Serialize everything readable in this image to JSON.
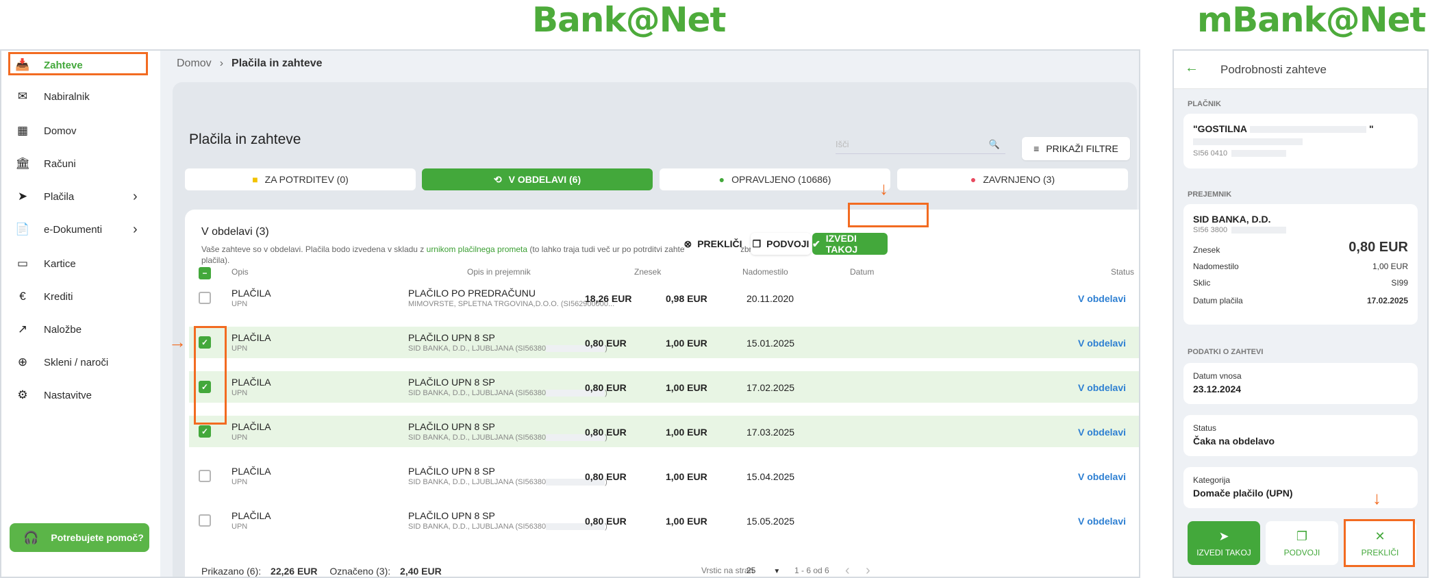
{
  "headers": {
    "desktop": "Bank@Net",
    "mobile": "mBank@Net"
  },
  "sidebar": {
    "items": [
      {
        "label": "Zahteve",
        "icon": "inbox-icon",
        "glyph": "📥",
        "chev": ""
      },
      {
        "label": "Nabiralnik",
        "icon": "mail-icon",
        "glyph": "✉",
        "chev": ""
      },
      {
        "label": "Domov",
        "icon": "dashboard-icon",
        "glyph": "▦",
        "chev": ""
      },
      {
        "label": "Računi",
        "icon": "bank-icon",
        "glyph": "🏛",
        "chev": ""
      },
      {
        "label": "Plačila",
        "icon": "send-icon",
        "glyph": "➤",
        "chev": "›"
      },
      {
        "label": "e-Dokumenti",
        "icon": "document-icon",
        "glyph": "📄",
        "chev": "›"
      },
      {
        "label": "Kartice",
        "icon": "card-icon",
        "glyph": "▭",
        "chev": ""
      },
      {
        "label": "Krediti",
        "icon": "euro-icon",
        "glyph": "€",
        "chev": ""
      },
      {
        "label": "Naložbe",
        "icon": "trend-icon",
        "glyph": "↗",
        "chev": ""
      },
      {
        "label": "Skleni / naroči",
        "icon": "plus-icon",
        "glyph": "⊕",
        "chev": ""
      },
      {
        "label": "Nastavitve",
        "icon": "gear-icon",
        "glyph": "⚙",
        "chev": ""
      }
    ],
    "help": "Potrebujete pomoč?"
  },
  "breadcrumb": {
    "home": "Domov",
    "sep": "›",
    "current": "Plačila in zahteve"
  },
  "main": {
    "title": "Plačila in zahteve",
    "search_placeholder": "Išči",
    "filters": "PRIKAŽI FILTRE"
  },
  "tabs": [
    {
      "label": "ZA POTRDITEV (0)",
      "glyph": "■",
      "color": "#f2c200"
    },
    {
      "label": "V OBDELAVI (6)",
      "glyph": "⟲",
      "color": "#ffffff"
    },
    {
      "label": "OPRAVLJENO (10686)",
      "glyph": "●",
      "color": "#43a83b"
    },
    {
      "label": "ZAVRNJENO (3)",
      "glyph": "●",
      "color": "#e84a5f"
    }
  ],
  "list": {
    "title": "V obdelavi (3)",
    "desc_pre": "Vaše zahteve so v obdelavi. Plačila bodo izvedena v skladu z ",
    "desc_link": "urnikom plačilnega prometa",
    "desc_post": " (to lahko traja tudi več ur po potrditvi zahteve oziroma na izbrani dan izvedbe plačila).",
    "btn_cancel": "PREKLIČI",
    "btn_dup": "PODVOJI",
    "btn_exec": "IZVEDI TAKOJ",
    "columns": [
      "Opis",
      "Opis in prejemnik",
      "Znesek",
      "Nadomestilo",
      "Datum",
      "Status"
    ],
    "rows": [
      {
        "sel": false,
        "title": "PLAČILA",
        "sub": "UPN",
        "rtitle": "PLAČILO PO PREDRAČUNU",
        "rsub": "MIMOVRSTE, SPLETNA TRGOVINA,D.O.O. (SI562900000...",
        "masked": false,
        "amount": "18,26 EUR",
        "fee": "0,98 EUR",
        "date": "20.11.2020",
        "status": "V obdelavi"
      },
      {
        "sel": true,
        "title": "PLAČILA",
        "sub": "UPN",
        "rtitle": "PLAČILO UPN 8 SP",
        "rsub": "SID BANKA, D.D., LJUBLJANA (SI56380",
        "masked": true,
        "amount": "0,80 EUR",
        "fee": "1,00 EUR",
        "date": "15.01.2025",
        "status": "V obdelavi"
      },
      {
        "sel": true,
        "title": "PLAČILA",
        "sub": "UPN",
        "rtitle": "PLAČILO UPN 8 SP",
        "rsub": "SID BANKA, D.D., LJUBLJANA (SI56380",
        "masked": true,
        "amount": "0,80 EUR",
        "fee": "1,00 EUR",
        "date": "17.02.2025",
        "status": "V obdelavi"
      },
      {
        "sel": true,
        "title": "PLAČILA",
        "sub": "UPN",
        "rtitle": "PLAČILO UPN 8 SP",
        "rsub": "SID BANKA, D.D., LJUBLJANA (SI56380",
        "masked": true,
        "amount": "0,80 EUR",
        "fee": "1,00 EUR",
        "date": "17.03.2025",
        "status": "V obdelavi"
      },
      {
        "sel": false,
        "title": "PLAČILA",
        "sub": "UPN",
        "rtitle": "PLAČILO UPN 8 SP",
        "rsub": "SID BANKA, D.D., LJUBLJANA (SI56380",
        "masked": true,
        "amount": "0,80 EUR",
        "fee": "1,00 EUR",
        "date": "15.04.2025",
        "status": "V obdelavi"
      },
      {
        "sel": false,
        "title": "PLAČILA",
        "sub": "UPN",
        "rtitle": "PLAČILO UPN 8 SP",
        "rsub": "SID BANKA, D.D., LJUBLJANA (SI56380",
        "masked": true,
        "amount": "0,80 EUR",
        "fee": "1,00 EUR",
        "date": "15.05.2025",
        "status": "V obdelavi"
      }
    ],
    "footer": {
      "shown_label": "Prikazano (6):",
      "shown_val": "22,26 EUR",
      "marked_label": "Označeno (3):",
      "marked_val": "2,40 EUR",
      "per_page_label": "Vrstic na stran",
      "per_page": "25",
      "range": "1 - 6 od 6"
    }
  },
  "mobile": {
    "title": "Podrobnosti zahteve",
    "payer_label": "PLAČNIK",
    "payer_name_a": "\"GOSTILNA",
    "payer_name_b": "\"",
    "payer_iban": "SI56 0410",
    "recipient_label": "PREJEMNIK",
    "recipient_name": "SID BANKA, D.D.",
    "recipient_iban": "SI56 3800",
    "amount_label": "Znesek",
    "amount": "0,80 EUR",
    "fee_label": "Nadomestilo",
    "fee": "1,00 EUR",
    "ref_label": "Sklic",
    "ref": "SI99",
    "date_label": "Datum plačila",
    "date": "17.02.2025",
    "req_label": "PODATKI O ZAHTEVI",
    "entry_label": "Datum vnosa",
    "entry": "23.12.2024",
    "status_label": "Status",
    "status": "Čaka na obdelavo",
    "cat_label": "Kategorija",
    "cat": "Domače plačilo (UPN)",
    "btn_exec": "IZVEDI TAKOJ",
    "btn_dup": "PODVOJI",
    "btn_cancel": "PREKLIČI"
  },
  "colors": {
    "brand": "#43a83b",
    "highlight": "#f26b21",
    "status": "#2d7fd2"
  }
}
